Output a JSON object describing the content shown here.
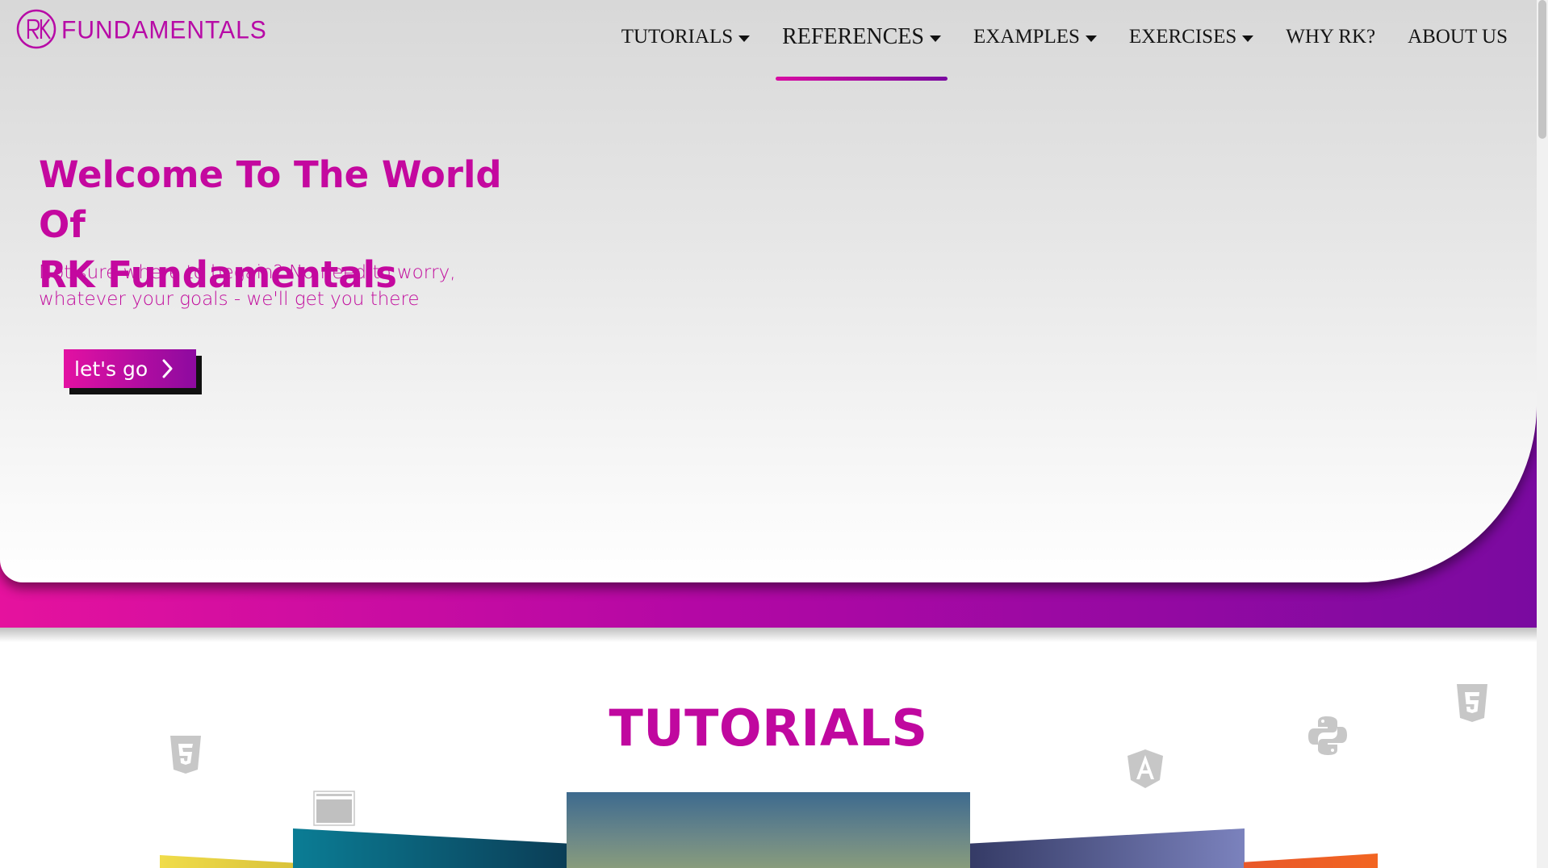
{
  "brand": {
    "logo_text": "FUNDAMENTALS",
    "logo_monogram": "RK",
    "accent_pink": "#e5129e",
    "accent_purple": "#7a0aa0",
    "title_color": "#c4089f"
  },
  "nav": {
    "items": [
      {
        "label": "TUTORIALS",
        "has_dropdown": true,
        "active": false
      },
      {
        "label": "REFERENCES",
        "has_dropdown": true,
        "active": true
      },
      {
        "label": "EXAMPLES",
        "has_dropdown": true,
        "active": false
      },
      {
        "label": "EXERCISES",
        "has_dropdown": true,
        "active": false
      },
      {
        "label": "WHY RK?",
        "has_dropdown": false,
        "active": false
      },
      {
        "label": "ABOUT US",
        "has_dropdown": false,
        "active": false
      }
    ]
  },
  "hero": {
    "title_line1": "Welcome To The World Of",
    "title_line2": "RK Fundamentals",
    "subtitle_line1": "Not sure where to begain? No need to worry,",
    "subtitle_line2": "whatever your goals - we'll get you there",
    "cta_label": "let's go",
    "cta_icon": "chevron-right-icon"
  },
  "tutorials": {
    "title": "TUTORIALS",
    "deco_icons": [
      "html5-icon",
      "browser-window-icon",
      "angular-icon",
      "python-icon",
      "css3-icon"
    ]
  }
}
